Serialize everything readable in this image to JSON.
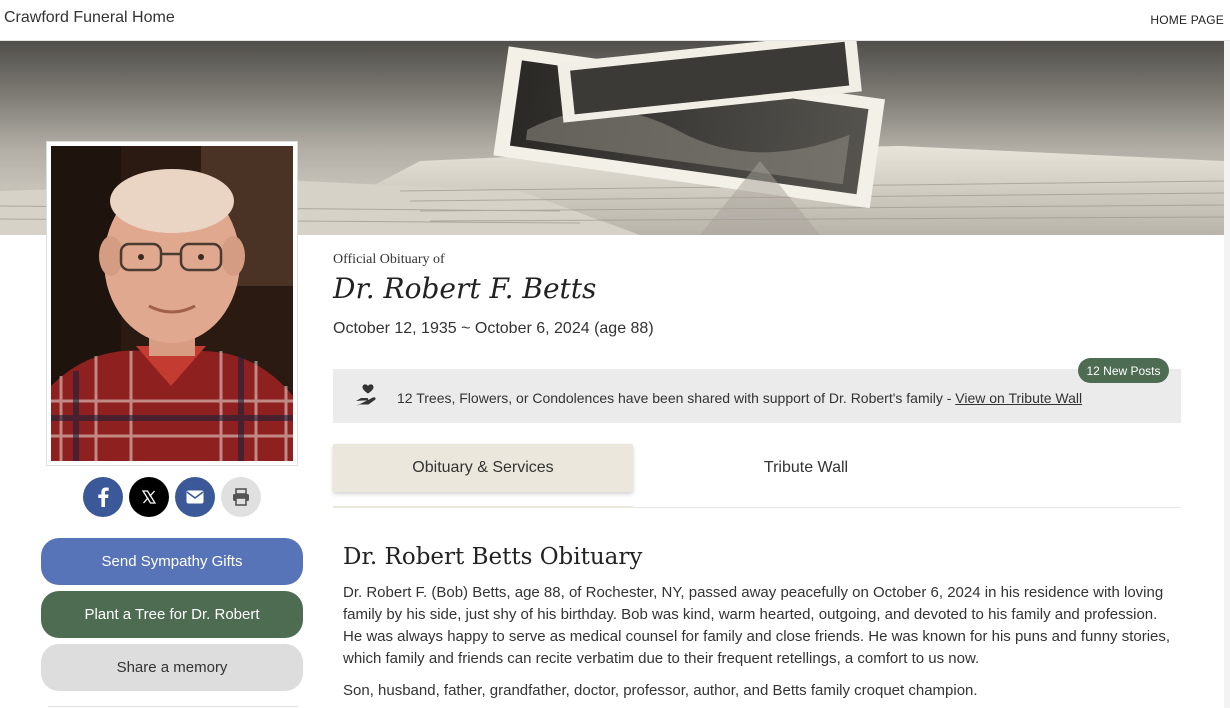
{
  "header": {
    "brand": "Crawford Funeral Home",
    "home_link": "HOME PAGE"
  },
  "profile": {
    "photo_alt": "Portrait of Dr. Robert F. Betts",
    "official_label": "Official Obituary of",
    "name": "Dr. Robert F. Betts",
    "dates": "October 12, 1935 ~ October 6, 2024 (age 88)"
  },
  "share": {
    "icons": [
      "facebook-icon",
      "x-icon",
      "email-icon",
      "print-icon"
    ],
    "colors": {
      "facebook": "#3b5998",
      "x": "#000000",
      "email": "#3b5998",
      "print": "#e0e0e0"
    }
  },
  "actions": {
    "send_gifts": "Send Sympathy Gifts",
    "plant_tree": "Plant a Tree for Dr. Robert",
    "share_memory": "Share a memory"
  },
  "tribute_notice": {
    "text": "12 Trees, Flowers, or Condolences have been shared with support of Dr. Robert's family - ",
    "link": "View on Tribute Wall",
    "badge": "12 New Posts"
  },
  "tabs": [
    {
      "label": "Obituary & Services",
      "active": true
    },
    {
      "label": "Tribute Wall",
      "active": false
    }
  ],
  "obituary": {
    "title": "Dr. Robert Betts Obituary",
    "paragraphs": [
      "Dr. Robert F. (Bob) Betts, age 88, of Rochester, NY, passed away peacefully on October 6, 2024 in his residence with loving family by his side, just shy of his birthday. Bob was kind, warm hearted, outgoing, and devoted to his family and profession. He was always happy to serve as medical counsel for family and close friends. He was known for his puns and funny stories, which family and friends can recite verbatim due to their frequent retellings, a comfort to us now.",
      "Son, husband, father, grandfather, doctor, professor, author, and Betts family croquet champion."
    ]
  },
  "colors": {
    "accent_green": "#4d6c52",
    "accent_blue": "#5774b8",
    "tab_active_bg": "#ebe7dc",
    "notice_bg": "#ebebeb"
  }
}
